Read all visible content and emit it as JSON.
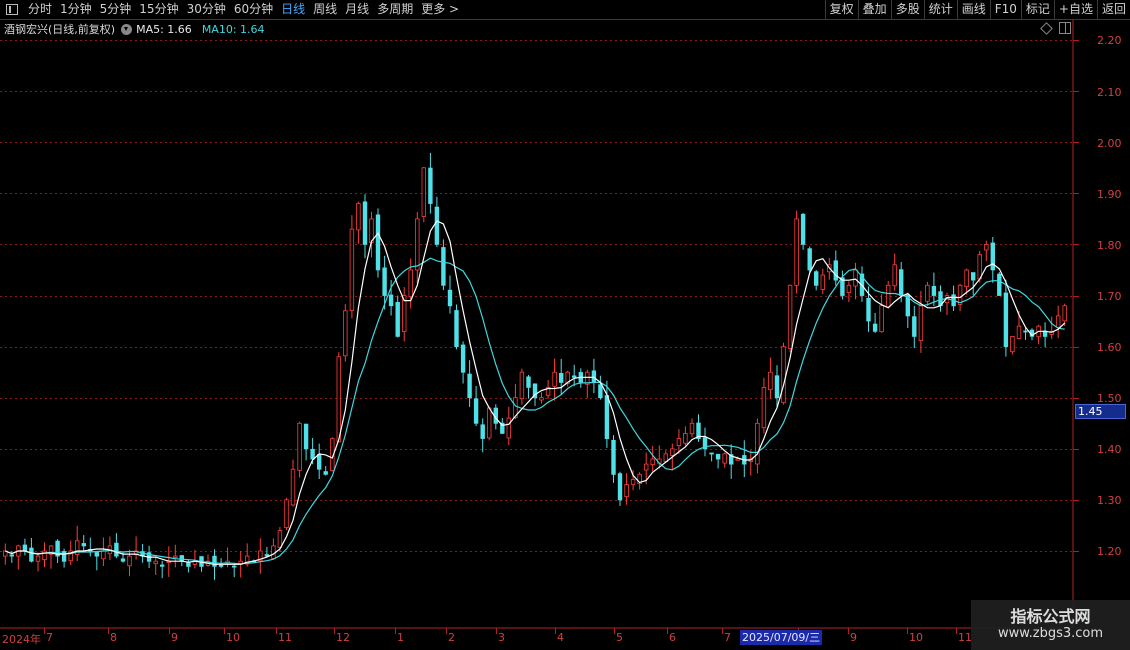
{
  "toolbar": {
    "periods": [
      {
        "label": "分时",
        "active": false
      },
      {
        "label": "1分钟",
        "active": false
      },
      {
        "label": "5分钟",
        "active": false
      },
      {
        "label": "15分钟",
        "active": false
      },
      {
        "label": "30分钟",
        "active": false
      },
      {
        "label": "60分钟",
        "active": false
      },
      {
        "label": "日线",
        "active": true
      },
      {
        "label": "周线",
        "active": false
      },
      {
        "label": "月线",
        "active": false
      },
      {
        "label": "多周期",
        "active": false
      },
      {
        "label": "更多 >",
        "active": false
      }
    ],
    "right_buttons": [
      "复权",
      "叠加",
      "多股",
      "统计",
      "画线",
      "F10",
      "标记",
      "+自选",
      "返回"
    ]
  },
  "info": {
    "stock_name": "酒钢宏兴(日线,前复权)",
    "ma5_label": "MA5: 1.66",
    "ma10_label": "MA10: 1.64"
  },
  "current_price": "1.45",
  "date_tip": "2025/07/09/三",
  "watermark": {
    "title": "指标公式网",
    "url": "www.zbgs3.com"
  },
  "colors": {
    "up": "#ff3c3c",
    "down": "#4fe0e8",
    "ma5": "#ffffff",
    "ma10": "#3fd8e0",
    "grid": "#8a1a1a",
    "axis": "#b02020"
  },
  "chart_data": {
    "type": "candlestick",
    "ylim": [
      1.11,
      2.24
    ],
    "y_ticks": [
      "2.20",
      "2.10",
      "2.00",
      "1.90",
      "1.80",
      "1.70",
      "1.60",
      "1.50",
      "1.40",
      "1.30",
      "1.20"
    ],
    "x_labels": [
      "2024年",
      "7",
      "8",
      "9",
      "10",
      "11",
      "12",
      "1",
      "2",
      "3",
      "4",
      "5",
      "6",
      "7",
      "8",
      "9",
      "10",
      "11"
    ],
    "ma5_label": "MA5: 1.66",
    "ma10_label": "MA10: 1.64",
    "closes": [
      1.2,
      1.19,
      1.21,
      1.2,
      1.18,
      1.19,
      1.2,
      1.21,
      1.19,
      1.18,
      1.2,
      1.22,
      1.21,
      1.2,
      1.19,
      1.2,
      1.21,
      1.19,
      1.18,
      1.19,
      1.2,
      1.19,
      1.18,
      1.18,
      1.17,
      1.18,
      1.19,
      1.18,
      1.17,
      1.18,
      1.17,
      1.18,
      1.17,
      1.17,
      1.18,
      1.17,
      1.18,
      1.19,
      1.18,
      1.2,
      1.19,
      1.21,
      1.24,
      1.3,
      1.36,
      1.45,
      1.4,
      1.38,
      1.36,
      1.35,
      1.42,
      1.58,
      1.67,
      1.83,
      1.88,
      1.8,
      1.85,
      1.75,
      1.7,
      1.68,
      1.62,
      1.7,
      1.75,
      1.85,
      1.95,
      1.88,
      1.8,
      1.72,
      1.68,
      1.6,
      1.55,
      1.5,
      1.45,
      1.42,
      1.48,
      1.45,
      1.43,
      1.46,
      1.5,
      1.55,
      1.52,
      1.5,
      1.5,
      1.52,
      1.55,
      1.53,
      1.55,
      1.54,
      1.53,
      1.55,
      1.53,
      1.5,
      1.42,
      1.35,
      1.3,
      1.33,
      1.34,
      1.35,
      1.37,
      1.38,
      1.38,
      1.39,
      1.4,
      1.42,
      1.43,
      1.45,
      1.42,
      1.4,
      1.39,
      1.38,
      1.39,
      1.37,
      1.38,
      1.37,
      1.38,
      1.45,
      1.52,
      1.55,
      1.5,
      1.6,
      1.72,
      1.85,
      1.8,
      1.75,
      1.72,
      1.74,
      1.76,
      1.73,
      1.7,
      1.72,
      1.75,
      1.7,
      1.65,
      1.63,
      1.68,
      1.72,
      1.76,
      1.7,
      1.66,
      1.62,
      1.68,
      1.72,
      1.7,
      1.68,
      1.7,
      1.68,
      1.72,
      1.75,
      1.73,
      1.78,
      1.8,
      1.75,
      1.7,
      1.6,
      1.62,
      1.64,
      1.63,
      1.62,
      1.64,
      1.62,
      1.63,
      1.66,
      1.68
    ]
  }
}
